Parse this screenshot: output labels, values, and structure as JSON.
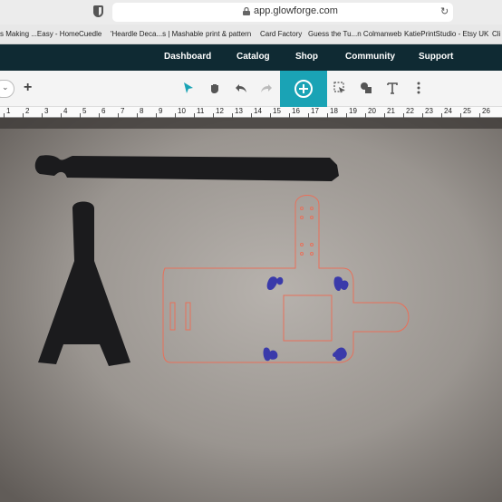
{
  "browser": {
    "url": "app.glowforge.com",
    "bookmarks": [
      "s Making ...Easy - Home",
      "Cuedle",
      "'Heardle Deca...s | Mashable",
      "print & pattern",
      "Card Factory",
      "Guess the Tu...n Colmanweb",
      "KatiePrintStudio - Etsy UK",
      "Cli"
    ]
  },
  "nav": {
    "items": [
      "Dashboard",
      "Catalog",
      "Shop",
      "Community",
      "Support"
    ]
  },
  "toolbar": {
    "dropdown_icon": "chevron-down-icon",
    "add_icon": "plus-icon",
    "tools": [
      "select-pointer-icon",
      "pan-hand-icon",
      "undo-icon",
      "redo-icon",
      "add-circle-icon",
      "trace-icon",
      "shapes-icon",
      "text-icon",
      "more-icon"
    ]
  },
  "ruler": {
    "labels": [
      "1",
      "2",
      "3",
      "4",
      "5",
      "6",
      "7",
      "8",
      "9",
      "10",
      "11",
      "12",
      "13",
      "14",
      "15",
      "16",
      "17",
      "18",
      "19",
      "20",
      "21",
      "22",
      "23",
      "24",
      "25",
      "26"
    ]
  },
  "colors": {
    "nav_bg": "#0f2a33",
    "accent": "#1aa3b5",
    "cut_line": "#e8705a",
    "engrave": "#3a3aaa"
  }
}
